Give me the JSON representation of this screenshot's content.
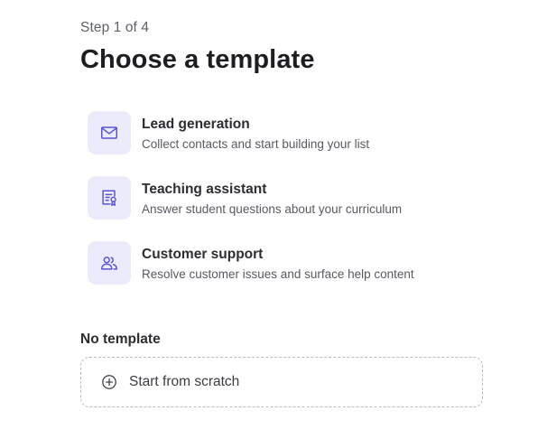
{
  "header": {
    "step": "Step 1 of 4",
    "title": "Choose a template"
  },
  "templates": [
    {
      "icon": "mail-icon",
      "title": "Lead generation",
      "description": "Collect contacts and start building your list"
    },
    {
      "icon": "certificate-icon",
      "title": "Teaching assistant",
      "description": "Answer student questions about your curriculum"
    },
    {
      "icon": "users-icon",
      "title": "Customer support",
      "description": "Resolve customer issues and surface help content"
    }
  ],
  "no_template": {
    "label": "No template",
    "button_label": "Start from scratch",
    "button_icon": "plus-circle-icon"
  },
  "colors": {
    "icon_bg": "#ecebfc",
    "icon_stroke": "#5a52d5",
    "dashed_border": "#b8bbc1"
  }
}
